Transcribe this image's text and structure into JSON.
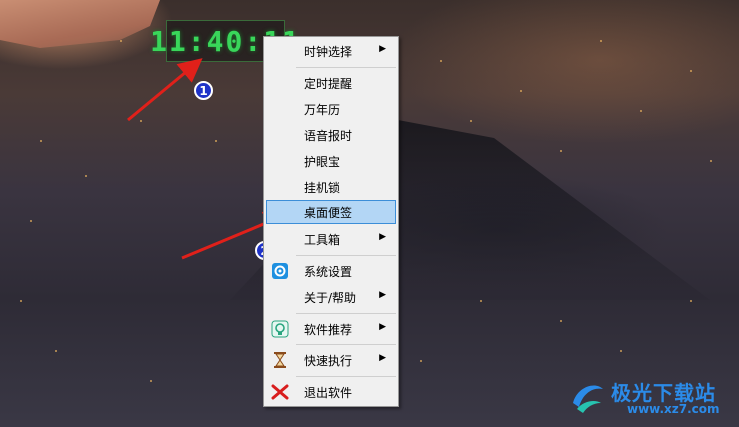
{
  "clock": {
    "time": "11:40:11"
  },
  "markers": [
    "1",
    "2"
  ],
  "menu": {
    "items": [
      {
        "label": "时钟选择",
        "submenu": true,
        "icon": null,
        "highlighted": false
      },
      {
        "label": "定时提醒",
        "submenu": false,
        "icon": null,
        "highlighted": false
      },
      {
        "label": "万年历",
        "submenu": false,
        "icon": null,
        "highlighted": false
      },
      {
        "label": "语音报时",
        "submenu": false,
        "icon": null,
        "highlighted": false
      },
      {
        "label": "护眼宝",
        "submenu": false,
        "icon": null,
        "highlighted": false
      },
      {
        "label": "挂机锁",
        "submenu": false,
        "icon": null,
        "highlighted": false
      },
      {
        "label": "桌面便签",
        "submenu": false,
        "icon": null,
        "highlighted": true
      },
      {
        "label": "工具箱",
        "submenu": true,
        "icon": null,
        "highlighted": false
      },
      {
        "label": "系统设置",
        "submenu": false,
        "icon": "gear-icon",
        "highlighted": false
      },
      {
        "label": "关于/帮助",
        "submenu": true,
        "icon": null,
        "highlighted": false
      },
      {
        "label": "软件推荐",
        "submenu": true,
        "icon": "lightbulb-icon",
        "highlighted": false
      },
      {
        "label": "快速执行",
        "submenu": true,
        "icon": "hourglass-icon",
        "highlighted": false
      },
      {
        "label": "退出软件",
        "submenu": false,
        "icon": "exit-x-icon",
        "highlighted": false
      }
    ],
    "submenu_glyph": "▶"
  },
  "watermark": {
    "title": "极光下载站",
    "url": "www.xz7.com"
  },
  "colors": {
    "highlight_bg": "#b3d6f5",
    "highlight_border": "#3c8ed8",
    "arrow": "#e0201a",
    "clock_digits": "#39d65a",
    "marker": "#1f33c8"
  }
}
